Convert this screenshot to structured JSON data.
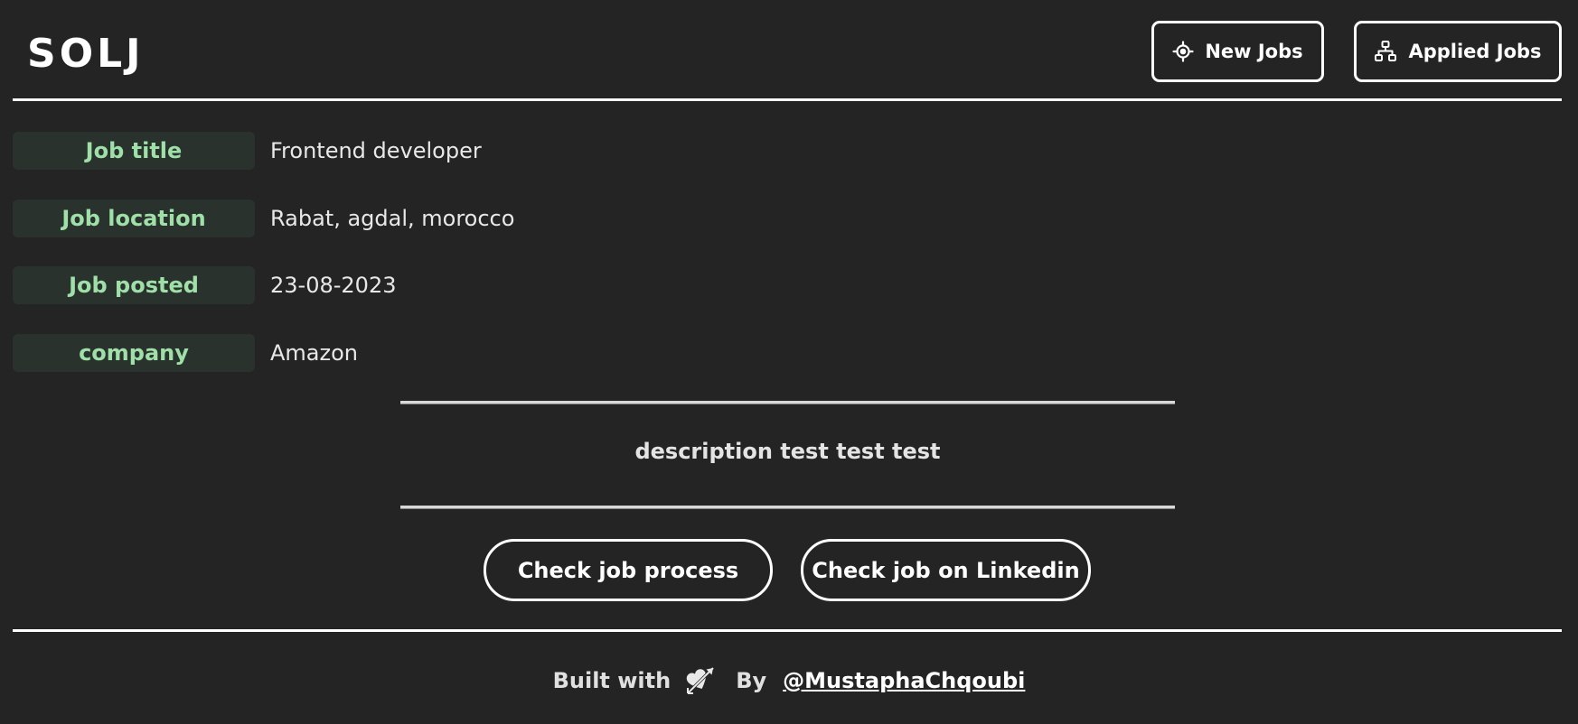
{
  "header": {
    "logo": "SOLJ",
    "nav": {
      "new_jobs": {
        "label": "New Jobs",
        "icon": "crosshair-icon"
      },
      "applied_jobs": {
        "label": "Applied Jobs",
        "icon": "sitemap-icon"
      }
    }
  },
  "job": {
    "fields": [
      {
        "label": "Job title",
        "value": "Frontend developer"
      },
      {
        "label": "Job location",
        "value": "Rabat, agdal, morocco"
      },
      {
        "label": "Job posted",
        "value": "23-08-2023"
      },
      {
        "label": "company",
        "value": "Amazon"
      }
    ],
    "description": "description test test test"
  },
  "actions": {
    "check_process": "Check job process",
    "check_linkedin": "Check job on Linkedin"
  },
  "footer": {
    "built_with": "Built with",
    "heart_icon": "heart-arrow-icon",
    "by": "By",
    "author": "@MustaphaChqoubi"
  },
  "colors": {
    "background": "#242424",
    "label_bg": "#2a322e",
    "label_text": "#9fdfa8",
    "border": "#ffffff"
  }
}
